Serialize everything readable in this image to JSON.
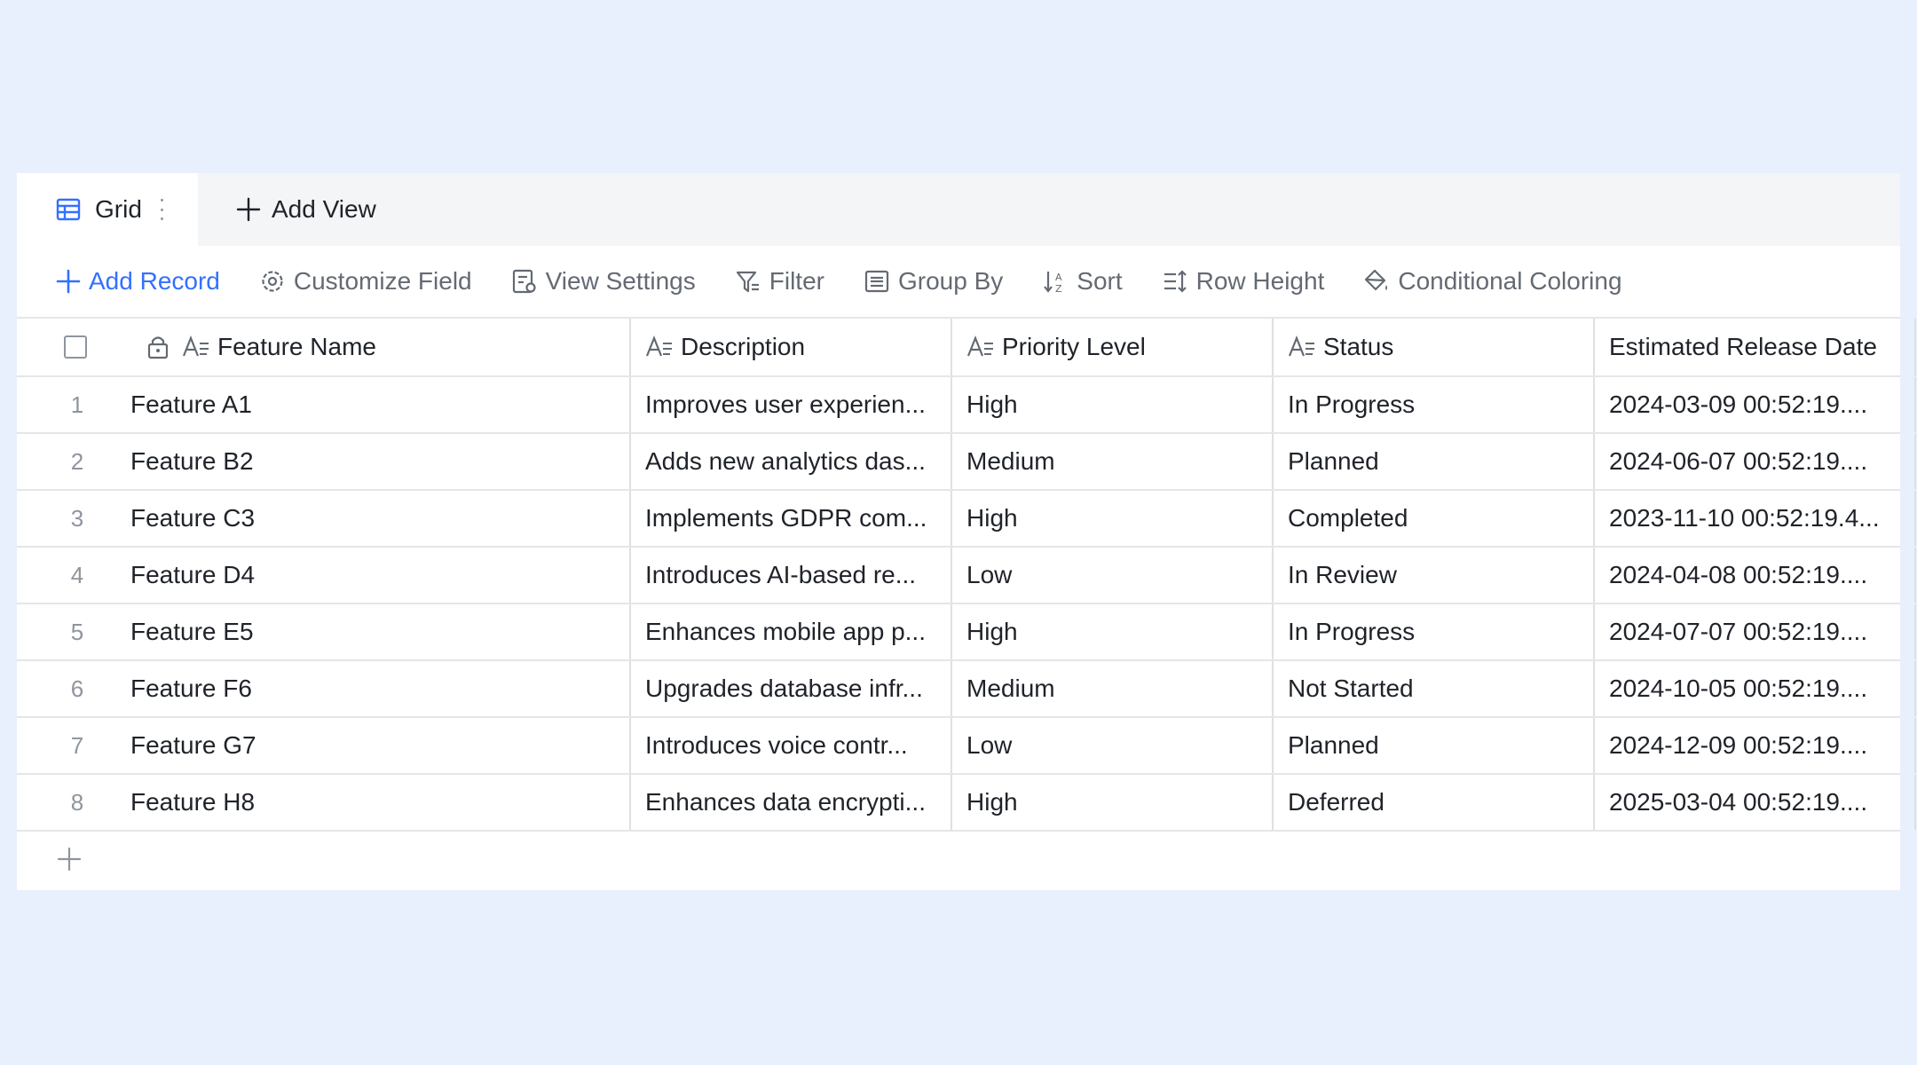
{
  "tabs": {
    "active_label": "Grid",
    "add_view_label": "Add View"
  },
  "toolbar": {
    "add_record": "Add Record",
    "customize_field": "Customize Field",
    "view_settings": "View Settings",
    "filter": "Filter",
    "group_by": "Group By",
    "sort": "Sort",
    "row_height": "Row Height",
    "conditional_coloring": "Conditional Coloring"
  },
  "columns": {
    "name": "Feature Name",
    "description": "Description",
    "priority": "Priority Level",
    "status": "Status",
    "release": "Estimated Release Date"
  },
  "rows": [
    {
      "index": "1",
      "name": "Feature A1",
      "description": "Improves user experien...",
      "priority": "High",
      "status": "In Progress",
      "release": "2024-03-09 00:52:19...."
    },
    {
      "index": "2",
      "name": "Feature B2",
      "description": "Adds new analytics das...",
      "priority": "Medium",
      "status": "Planned",
      "release": "2024-06-07 00:52:19...."
    },
    {
      "index": "3",
      "name": "Feature C3",
      "description": "Implements GDPR com...",
      "priority": "High",
      "status": "Completed",
      "release": "2023-11-10 00:52:19.4..."
    },
    {
      "index": "4",
      "name": "Feature D4",
      "description": "Introduces AI-based re...",
      "priority": "Low",
      "status": "In Review",
      "release": "2024-04-08 00:52:19...."
    },
    {
      "index": "5",
      "name": "Feature E5",
      "description": "Enhances mobile app p...",
      "priority": "High",
      "status": "In Progress",
      "release": "2024-07-07 00:52:19...."
    },
    {
      "index": "6",
      "name": "Feature F6",
      "description": "Upgrades database infr...",
      "priority": "Medium",
      "status": "Not Started",
      "release": "2024-10-05 00:52:19...."
    },
    {
      "index": "7",
      "name": "Feature G7",
      "description": "Introduces voice contr...",
      "priority": "Low",
      "status": "Planned",
      "release": "2024-12-09 00:52:19...."
    },
    {
      "index": "8",
      "name": "Feature H8",
      "description": "Enhances data encrypti...",
      "priority": "High",
      "status": "Deferred",
      "release": "2025-03-04 00:52:19...."
    }
  ],
  "colors": {
    "page_bg": "#e8effd",
    "accent": "#3370ff",
    "muted_text": "#646a73",
    "border": "#dee0e3"
  }
}
